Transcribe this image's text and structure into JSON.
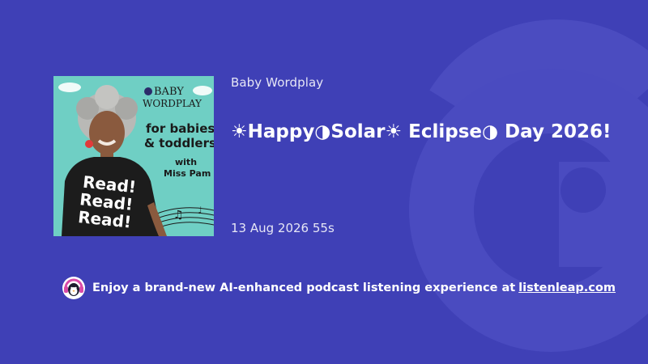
{
  "podcast": {
    "name": "Baby Wordplay",
    "cover": {
      "brand_line1": "BABY",
      "brand_line2": "WORDPLAY",
      "tagline_line1": "for babies",
      "tagline_line2": "& toddlers",
      "host_line1": "with",
      "host_line2": "Miss Pam",
      "shirt_text": [
        "Read!",
        "Read!",
        "Read!"
      ]
    }
  },
  "episode": {
    "title": "☀Happy◑Solar☀ Eclipse◑ Day 2026!",
    "meta": "13 Aug 2026 55s"
  },
  "promo": {
    "text": "Enjoy a brand-new AI-enhanced podcast listening experience at",
    "link": "listenleap.com",
    "logo_icon": "penguin-headphones-icon"
  },
  "colors": {
    "background": "#3f40b6",
    "cover_bg": "#6fcfc4"
  }
}
